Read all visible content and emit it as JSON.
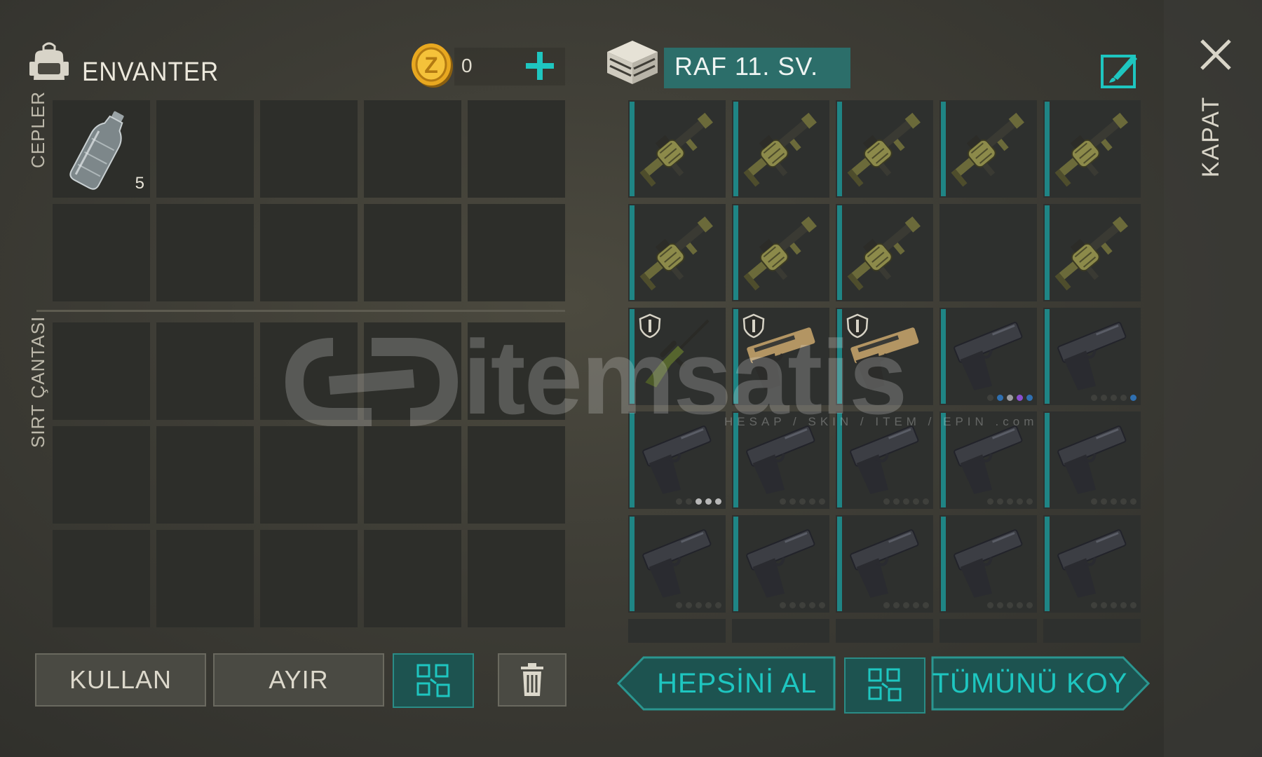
{
  "inventory": {
    "title": "ENVANTER",
    "coins": "0",
    "pockets_label": "CEPLER",
    "backpack_label": "SIRT ÇANTASI",
    "pocket_items": [
      {
        "icon": "water-bottle-icon",
        "qty": "5"
      }
    ]
  },
  "shelf": {
    "name": "RAF 11. SV.",
    "items": [
      {
        "type": "grenade-launcher"
      },
      {
        "type": "grenade-launcher"
      },
      {
        "type": "grenade-launcher"
      },
      {
        "type": "grenade-launcher"
      },
      {
        "type": "grenade-launcher"
      },
      {
        "type": "grenade-launcher"
      },
      {
        "type": "grenade-launcher"
      },
      {
        "type": "grenade-launcher"
      },
      {
        "type": "empty"
      },
      {
        "type": "grenade-launcher"
      },
      {
        "type": "sniper-rifle",
        "shield": true
      },
      {
        "type": "desert-eagle",
        "shield": true
      },
      {
        "type": "desert-eagle",
        "shield": true
      },
      {
        "type": "pistol",
        "dots": [
          "#3f403c",
          "#2f6fb0",
          "#9b9ba0",
          "#8a4fd0",
          "#2f6fb0"
        ]
      },
      {
        "type": "pistol",
        "dots": [
          "#3f403c",
          "#3f403c",
          "#3f403c",
          "#3f403c",
          "#2f6fb0"
        ]
      },
      {
        "type": "pistol",
        "dots": [
          "#3f403c",
          "#3f403c",
          "#b8b8b8",
          "#b8b8b8",
          "#b8b8b8"
        ]
      },
      {
        "type": "pistol",
        "dots": [
          "#3f403c",
          "#3f403c",
          "#3f403c",
          "#3f403c",
          "#3f403c"
        ]
      },
      {
        "type": "pistol",
        "dots": [
          "#3f403c",
          "#3f403c",
          "#3f403c",
          "#3f403c",
          "#3f403c"
        ]
      },
      {
        "type": "pistol",
        "dots": [
          "#3f403c",
          "#3f403c",
          "#3f403c",
          "#3f403c",
          "#3f403c"
        ]
      },
      {
        "type": "pistol",
        "dots": [
          "#3f403c",
          "#3f403c",
          "#3f403c",
          "#3f403c",
          "#3f403c"
        ]
      },
      {
        "type": "pistol",
        "dots": [
          "#3f403c",
          "#3f403c",
          "#3f403c",
          "#3f403c",
          "#3f403c"
        ]
      },
      {
        "type": "pistol",
        "dots": [
          "#3f403c",
          "#3f403c",
          "#3f403c",
          "#3f403c",
          "#3f403c"
        ]
      },
      {
        "type": "pistol",
        "dots": [
          "#3f403c",
          "#3f403c",
          "#3f403c",
          "#3f403c",
          "#3f403c"
        ]
      },
      {
        "type": "pistol",
        "dots": [
          "#3f403c",
          "#3f403c",
          "#3f403c",
          "#3f403c",
          "#3f403c"
        ]
      },
      {
        "type": "pistol",
        "dots": [
          "#3f403c",
          "#3f403c",
          "#3f403c",
          "#3f403c",
          "#3f403c"
        ]
      }
    ]
  },
  "actions": {
    "use": "KULLAN",
    "split": "AYIR",
    "take_all": "HEPSİNİ AL",
    "put_all": "TÜMÜNÜ KOY",
    "close": "KAPAT"
  },
  "watermark": {
    "text": "itemsatis",
    "sub": "HESAP / SKIN / ITEM / EPIN  .com"
  },
  "colors": {
    "accent": "#1ec6c0",
    "accent_dark": "#1d5350",
    "cell": "#2d2e2a"
  }
}
